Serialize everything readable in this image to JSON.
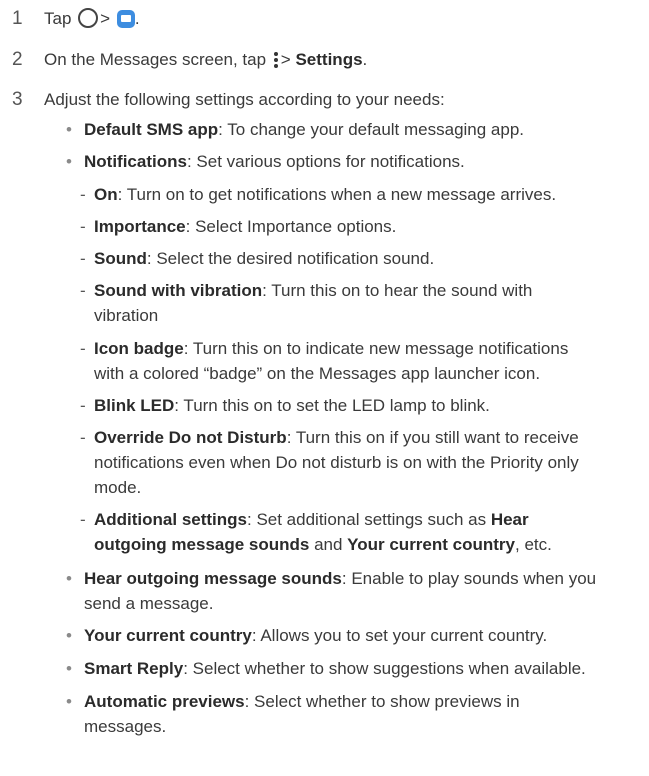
{
  "steps": [
    {
      "num": "1",
      "text_before": "Tap",
      "text_gt": ">"
    },
    {
      "num": "2",
      "text_before": "On the Messages screen, tap",
      "text_gt": ">",
      "bold": "Settings",
      "text_after": "."
    },
    {
      "num": "3",
      "text": "Adjust the following settings according to your needs:"
    }
  ],
  "step1_end": ".",
  "icons": {
    "home": "home-circle-icon",
    "messages": "messages-app-icon",
    "more": "more-options-icon"
  },
  "colors": {
    "messages_icon": "#3d8de0"
  },
  "bullets": {
    "default_sms": {
      "label": "Default SMS app",
      "desc": ": To change your default messaging app."
    },
    "notifications": {
      "label": "Notifications",
      "desc": ": Set various options for notifications."
    },
    "hear_outgoing": {
      "label": "Hear outgoing message sounds",
      "desc_1": ": Enable to play sounds when you",
      "desc_2": "send a message."
    },
    "current_country": {
      "label": "Your current country",
      "desc": ": Allows you to set your current country."
    },
    "smart_reply": {
      "label": "Smart Reply",
      "desc": ": Select whether to show suggestions when available."
    },
    "auto_previews": {
      "label": "Automatic previews",
      "desc_1": ": Select whether to show previews in",
      "desc_2": "messages."
    }
  },
  "subitems": {
    "on": {
      "label": "On",
      "desc": ": Turn on to get notifications when a new message arrives."
    },
    "importance": {
      "label": "Importance",
      "desc": ": Select Importance options."
    },
    "sound": {
      "label": "Sound",
      "desc": ": Select the desired notification sound."
    },
    "sound_vibration": {
      "label": "Sound with vibration",
      "desc_1": ": Turn this on to hear the sound with",
      "desc_2": "vibration"
    },
    "icon_badge": {
      "label": "Icon badge",
      "desc_1": ": Turn this on to indicate new message notifications",
      "desc_2": "with a colored “badge” on the Messages app launcher icon."
    },
    "blink_led": {
      "label": "Blink LED",
      "desc": ": Turn this on to set the LED lamp to blink."
    },
    "override_dnd": {
      "label": "Override Do not Disturb",
      "desc_1": ": Turn this on if you still want to receive",
      "desc_2": "notifications even when Do not disturb is on with the Priority only",
      "desc_3": "mode."
    },
    "additional": {
      "label": "Additional settings",
      "desc_1": ": Set additional settings such as ",
      "bold_1": "Hear",
      "bold_2": "outgoing message sounds",
      "and": " and ",
      "bold_3": "Your current country",
      "end": ", etc."
    }
  }
}
